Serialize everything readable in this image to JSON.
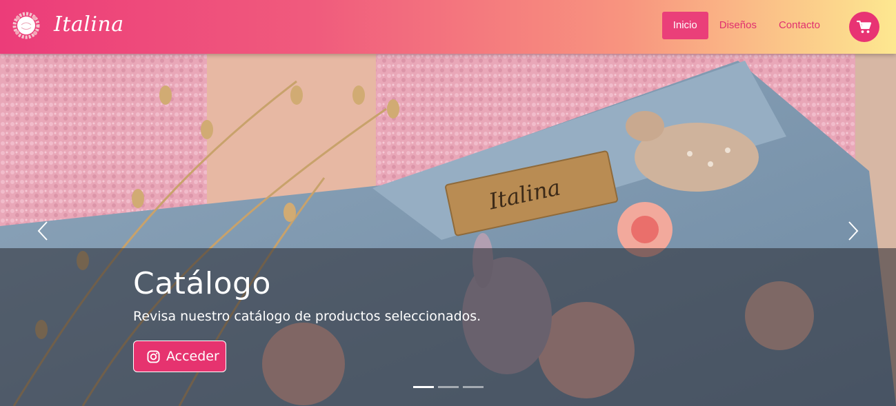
{
  "brand": {
    "name": "Italina"
  },
  "nav": {
    "links": [
      {
        "label": "Inicio",
        "active": true
      },
      {
        "label": "Diseños",
        "active": false
      },
      {
        "label": "Contacto",
        "active": false
      }
    ]
  },
  "hero": {
    "title": "Catálogo",
    "text": "Revisa nuestro catálogo de productos seleccionados.",
    "button_label": "Acceder",
    "button_icon": "instagram-icon",
    "product_tag": "Italina"
  },
  "colors": {
    "accent": "#e83373",
    "nav_gradient_start": "#ec3c79",
    "nav_gradient_end": "#fde890"
  },
  "carousel": {
    "slides": 3,
    "active_slide": 1
  }
}
